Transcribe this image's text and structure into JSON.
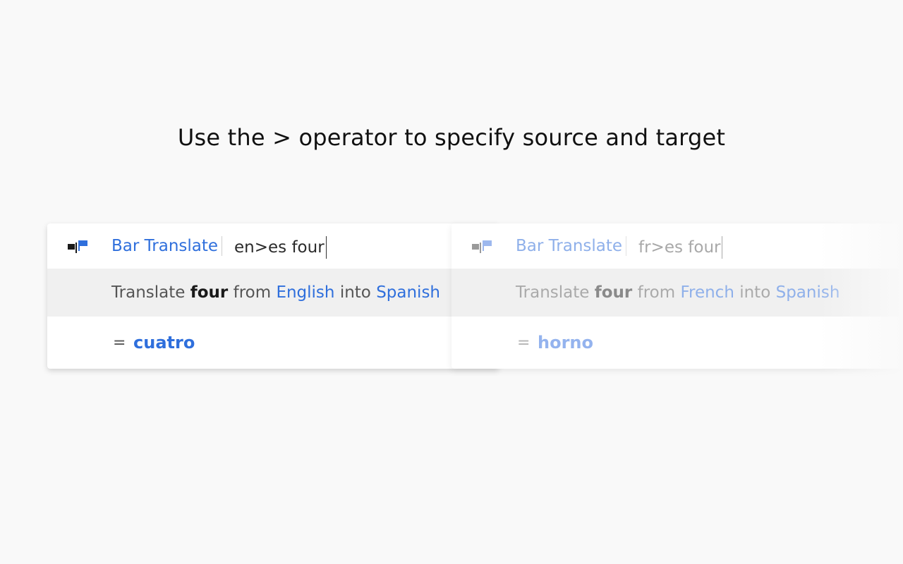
{
  "headline": "Use the > operator to specify source and target",
  "colors": {
    "accent": "#2f6fdc",
    "accent_faded": "#8fb0ea",
    "background": "#f9f9f9",
    "suggestion_row": "#f0f0f0"
  },
  "examples": [
    {
      "icon": "flags-icon",
      "brand": "Bar Translate",
      "query": "en>es four",
      "suggestion": {
        "prefix": "Translate",
        "word": "four",
        "from_label": "from",
        "source": "English",
        "into_label": "into",
        "target": "Spanish"
      },
      "result_prefix": "=",
      "result": "cuatro"
    },
    {
      "icon": "flags-icon",
      "brand": "Bar Translate",
      "query": "fr>es four",
      "suggestion": {
        "prefix": "Translate",
        "word": "four",
        "from_label": "from",
        "source": "French",
        "into_label": "into",
        "target": "Spanish"
      },
      "result_prefix": "=",
      "result": "horno"
    }
  ]
}
